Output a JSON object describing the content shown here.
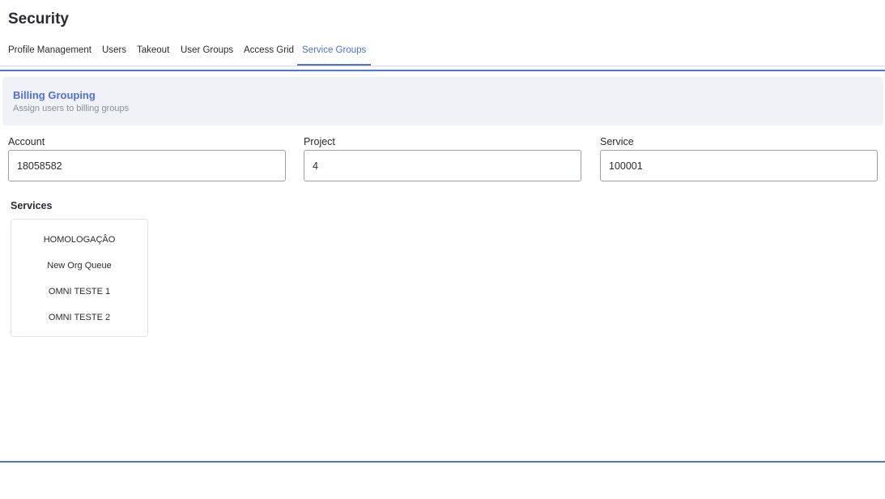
{
  "page": {
    "title": "Security"
  },
  "tabs": [
    {
      "label": "Profile Management",
      "active": false
    },
    {
      "label": "Users",
      "active": false
    },
    {
      "label": "Takeout",
      "active": false
    },
    {
      "label": "User Groups",
      "active": false
    },
    {
      "label": "Access Grid",
      "active": false
    },
    {
      "label": "Service Groups",
      "active": true
    }
  ],
  "banner": {
    "title": "Billing Grouping",
    "subtitle": "Assign users to billing groups"
  },
  "fields": {
    "account": {
      "label": "Account",
      "value": "18058582"
    },
    "project": {
      "label": "Project",
      "value": "4"
    },
    "service": {
      "label": "Service",
      "value": "100001"
    }
  },
  "services": {
    "heading": "Services",
    "items": [
      "HOMOLOGAÇÂO",
      "New Org Queue",
      "OMNI TESTE 1",
      "OMNI TESTE 2"
    ]
  },
  "colors": {
    "accent": "#4f6fdc",
    "banner_bg": "#f0f2f7",
    "rule": "#4f74e0"
  }
}
